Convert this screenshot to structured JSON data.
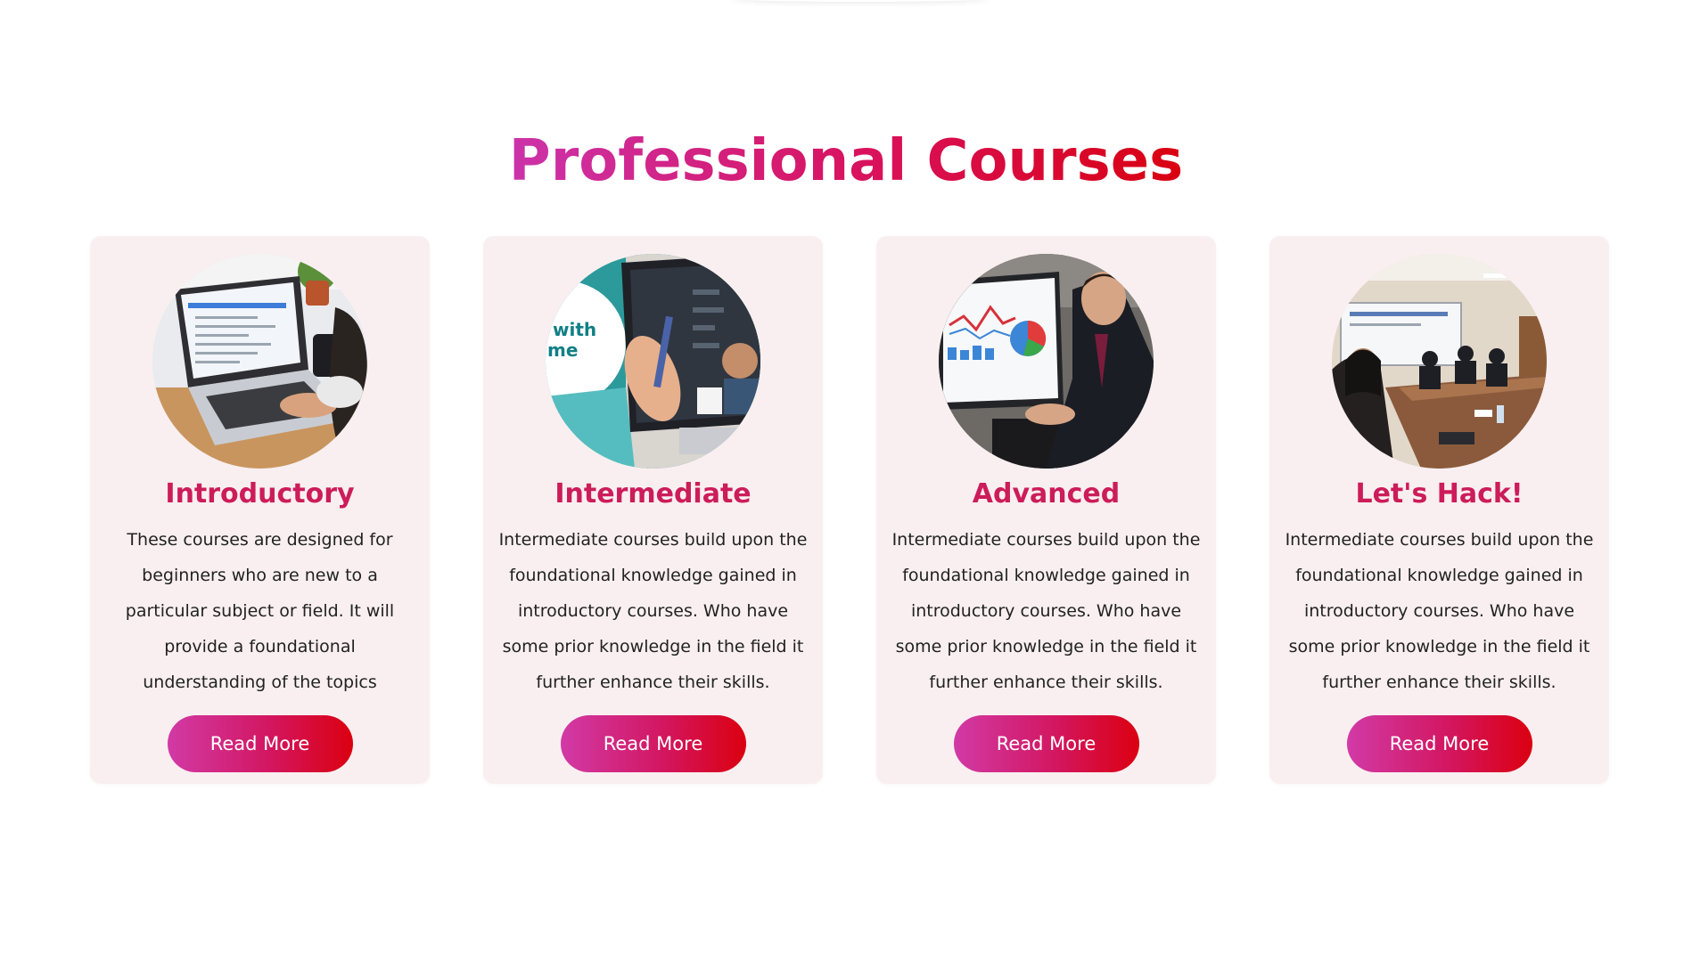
{
  "section": {
    "title": "Professional Courses"
  },
  "cards": [
    {
      "title": "Introductory",
      "description": "These courses are designed for beginners who are new to a particular subject or field. It will provide a foundational understanding of the topics",
      "button_label": "Read More"
    },
    {
      "title": "Intermediate",
      "description": "Intermediate courses build upon the foundational knowledge gained in introductory courses. Who have some prior knowledge in the field it further enhance their skills.",
      "button_label": "Read More",
      "image_text": [
        "with",
        "me"
      ]
    },
    {
      "title": "Advanced",
      "description": "Intermediate courses build upon the foundational knowledge gained in introductory courses. Who have some prior knowledge in the field it further enhance their skills.",
      "button_label": "Read More"
    },
    {
      "title": "Let's Hack!",
      "description": "Intermediate courses build upon the foundational knowledge gained in introductory courses. Who have some prior knowledge in the field it further enhance their skills.",
      "button_label": "Read More"
    }
  ],
  "colors": {
    "title_gradient_start": "#cc33aa",
    "title_gradient_end": "#d90010",
    "card_title": "#cc1c5a",
    "card_background": "#f9eff0",
    "button_gradient_start": "#d13aa6",
    "button_gradient_end": "#db0010"
  }
}
